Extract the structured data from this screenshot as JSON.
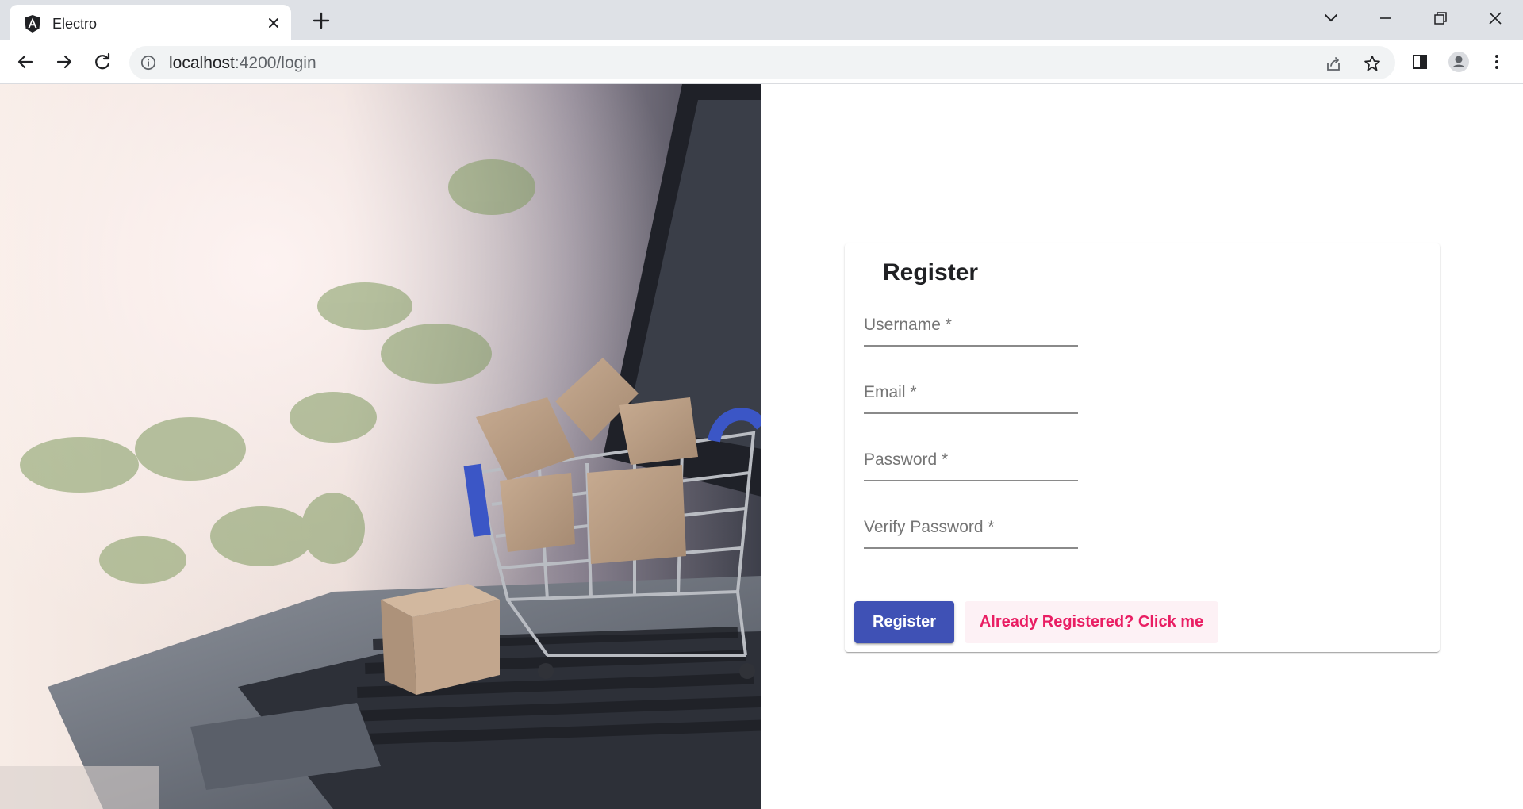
{
  "browser": {
    "tab_title": "Electro",
    "url_host": "localhost",
    "url_rest": ":4200/login"
  },
  "register_form": {
    "title": "Register",
    "fields": {
      "username_placeholder": "Username *",
      "email_placeholder": "Email *",
      "password_placeholder": "Password *",
      "verify_password_placeholder": "Verify Password *"
    },
    "register_button": "Register",
    "login_link_button": "Already Registered? Click me"
  },
  "colors": {
    "primary": "#3f51b5",
    "accent": "#e91e63",
    "accent_bg": "#fdf1f5"
  },
  "icons": {
    "favicon": "angular-icon",
    "hero": "shopping-cart-laptop-photo"
  }
}
